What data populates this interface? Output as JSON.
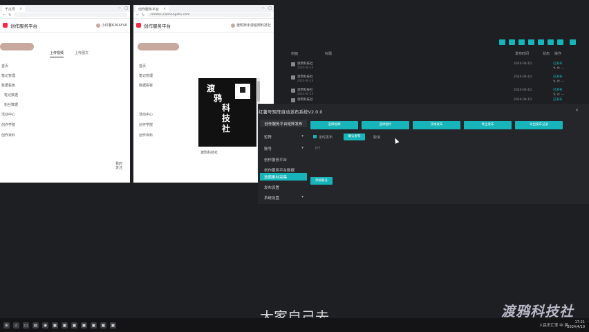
{
  "browser1": {
    "tab_title": "千瓜号",
    "app_title": "创作服务平台",
    "account": "小红薯636AF46",
    "upload_tabs": [
      "上传视频",
      "上传图文"
    ],
    "sidebar": [
      "首页",
      "笔记管理",
      "数据看板",
      "笔记数据",
      "粉丝数据",
      "活动中心",
      "创作学院",
      "创作百科"
    ],
    "corner_text": "我的\n关注"
  },
  "browser2": {
    "tab_title": "创作服务平台",
    "url": "creator.xiaohongshu.com",
    "app_title": "创作服务平台",
    "account": "渡鸦桥手游官网科技社",
    "sidebar": [
      "首页",
      "笔记管理",
      "数据看板",
      "活动中心",
      "创作学院",
      "创作百科"
    ],
    "poster_chars": [
      "渡",
      "鸦",
      "科",
      "技",
      "社"
    ],
    "caption_title": "渡鸦科技社"
  },
  "background_app": {
    "header_cols": [
      "封面",
      "标题",
      "发布时间",
      "状态",
      "操作"
    ],
    "rows": [
      {
        "title": "渡鸦科技社",
        "sub": "2024-04-10",
        "date": "2024-04-10",
        "status": "已发布"
      },
      {
        "title": "渡鸦科技社",
        "sub": "2024-04-10",
        "date": "2024-04-10",
        "status": "已发布"
      },
      {
        "title": "渡鸦科技社",
        "sub": "2024-04-10",
        "date": "2024-04-10",
        "status": "已发布"
      },
      {
        "title": "渡鸦科技社",
        "sub": "2024-04-10",
        "date": "2024-04-10",
        "status": "已发布"
      }
    ]
  },
  "tool_panel": {
    "title": "红薯号矩阵自动发布系统V2.0.0",
    "nav": [
      {
        "label": "创作服务平台矩阵发布",
        "first": true
      },
      {
        "label": "矩阵",
        "chev": "▾"
      },
      {
        "label": "账号",
        "chev": "▾"
      },
      {
        "label": "创作服务平台"
      },
      {
        "label": "创作服务平台数据"
      },
      {
        "label": "选题素材采集",
        "active": true
      },
      {
        "label": "发布设置"
      },
      {
        "label": "系统设置",
        "chev": "▾"
      }
    ],
    "action_buttons": [
      "选择视频",
      "选择图片",
      "开始发布",
      "停止发布",
      "导出发布记录"
    ],
    "checkbox_label": "定时发布",
    "primary_button": "确认发布",
    "secondary_text": "取消",
    "small_text": "7/7",
    "submit_button": "添加账号"
  },
  "subtitle": "大家自己去",
  "watermark": "渡鸦科技社",
  "tray": "人民币汇率 中 英",
  "clock": {
    "time": "17:21",
    "date": "2024/4/10"
  }
}
